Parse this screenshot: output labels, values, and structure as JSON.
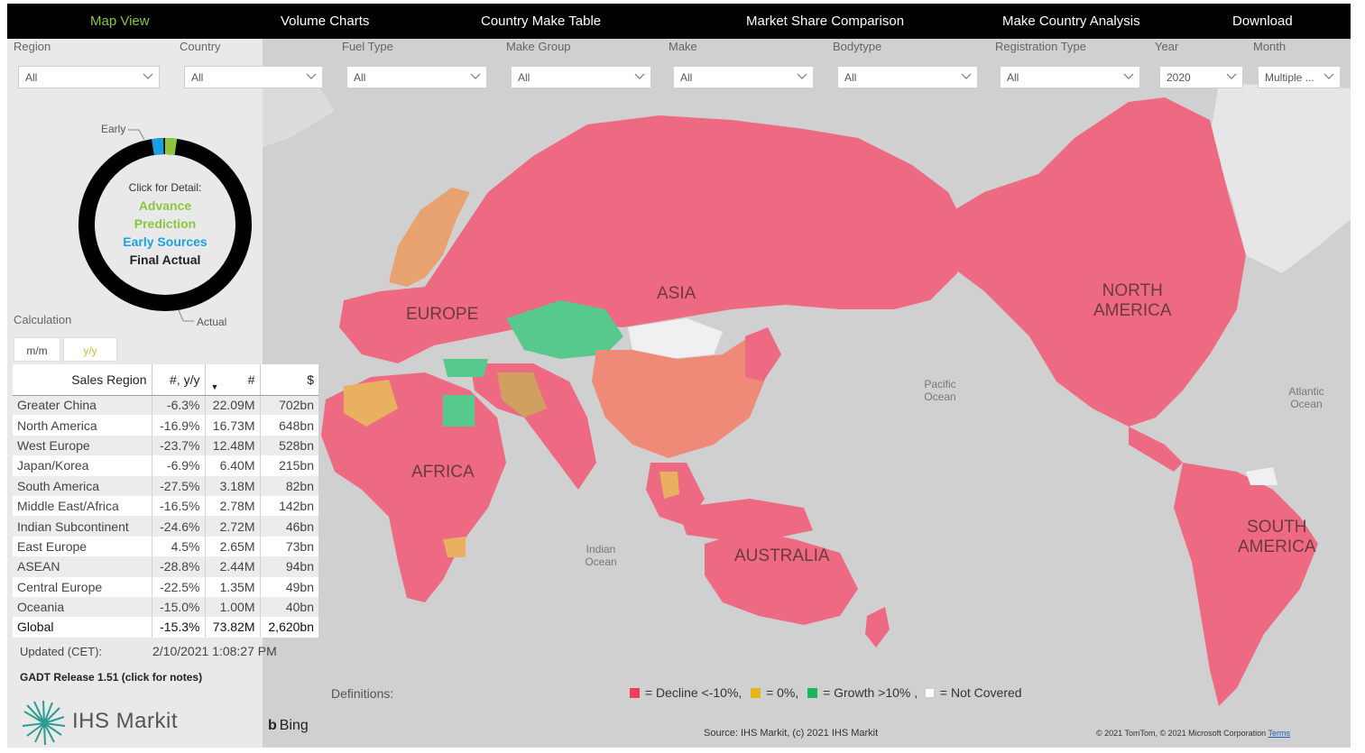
{
  "nav": {
    "items": [
      "Map View",
      "Volume Charts",
      "Country Make Table",
      "Market Share Comparison",
      "Make Country Analysis",
      "Download"
    ]
  },
  "filters": [
    {
      "label": "Region",
      "value": "All"
    },
    {
      "label": "Country",
      "value": "All"
    },
    {
      "label": "Fuel Type",
      "value": "All"
    },
    {
      "label": "Make Group",
      "value": "All"
    },
    {
      "label": "Make",
      "value": "All"
    },
    {
      "label": "Bodytype",
      "value": "All"
    },
    {
      "label": "Registration Type",
      "value": "All"
    },
    {
      "label": "Year",
      "value": "2020"
    },
    {
      "label": "Month",
      "value": "Multiple ..."
    }
  ],
  "donut": {
    "label_early": "Early",
    "label_actual": "Actual",
    "lines": {
      "click": "Click for Detail:",
      "advance": "Advance",
      "prediction": "Prediction",
      "early": "Early Sources",
      "final": "Final Actual"
    },
    "colors": {
      "advance": "#8cc63f",
      "early": "#1ba1e2",
      "final": "#000000"
    }
  },
  "calculation": {
    "label": "Calculation",
    "options": [
      "m/m",
      "y/y"
    ],
    "selected": "y/y"
  },
  "table": {
    "headers": [
      "Sales Region",
      "#, y/y",
      "#",
      "$"
    ],
    "rows": [
      [
        "Greater China",
        "-6.3%",
        "22.09M",
        "702bn"
      ],
      [
        "North America",
        "-16.9%",
        "16.73M",
        "648bn"
      ],
      [
        "West Europe",
        "-23.7%",
        "12.48M",
        "528bn"
      ],
      [
        "Japan/Korea",
        "-6.9%",
        "6.40M",
        "215bn"
      ],
      [
        "South America",
        "-27.5%",
        "3.18M",
        "82bn"
      ],
      [
        "Middle East/Africa",
        "-16.5%",
        "2.78M",
        "142bn"
      ],
      [
        "Indian Subcontinent",
        "-24.6%",
        "2.72M",
        "46bn"
      ],
      [
        "East Europe",
        "4.5%",
        "2.65M",
        "73bn"
      ],
      [
        "ASEAN",
        "-28.8%",
        "2.44M",
        "94bn"
      ],
      [
        "Central Europe",
        "-22.5%",
        "1.35M",
        "49bn"
      ],
      [
        "Oceania",
        "-15.0%",
        "1.00M",
        "40bn"
      ]
    ],
    "total": [
      "Global",
      "-15.3%",
      "73.82M",
      "2,620bn"
    ]
  },
  "updated": {
    "label": "Updated (CET):",
    "value": "2/10/2021 1:08:27 PM"
  },
  "release": "GADT Release 1.51 (click for notes)",
  "brand": "IHS Markit",
  "map": {
    "regions": [
      "EUROPE",
      "ASIA",
      "AFRICA",
      "AUSTRALIA",
      "NORTH\nAMERICA",
      "SOUTH\nAMERICA"
    ],
    "oceans": [
      "Pacific Ocean",
      "Indian Ocean",
      "Atlantic Ocean"
    ],
    "colors": {
      "decline": "#ee6a82",
      "flat": "#e8b060",
      "growth": "#58c98c",
      "not_covered": "#f0f0f0",
      "land_neutral": "#e3e3e3",
      "water": "#d0d0d0"
    }
  },
  "bing": "Bing",
  "definitions": "Definitions:",
  "legend": {
    "decline": "= Decline <-10%,",
    "flat": "= 0%,",
    "growth": "= Growth >10% ,",
    "not_covered": "= Not Covered",
    "colors": {
      "decline": "#ee3e5e",
      "flat": "#e2b614",
      "growth": "#1ab55c",
      "not_covered": "#ffffff"
    }
  },
  "source": "Source: IHS Markit, (c) 2021 IHS Markit",
  "copyright": "© 2021 TomTom, © 2021 Microsoft Corporation",
  "terms": "Terms"
}
